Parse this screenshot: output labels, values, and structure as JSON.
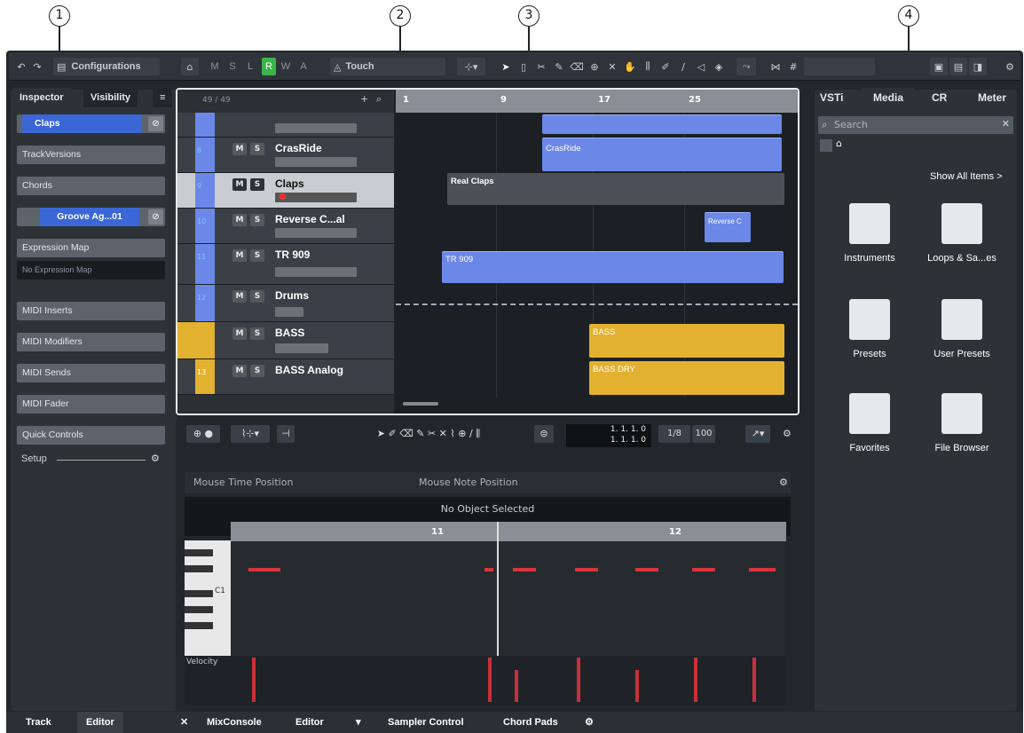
{
  "callouts": [
    "1",
    "2",
    "3",
    "4"
  ],
  "toolbar": {
    "configurations_label": "Configurations",
    "mode_letters": [
      "M",
      "S",
      "L",
      "R",
      "W",
      "A"
    ],
    "automation_mode": "Touch"
  },
  "inspector": {
    "tabs": [
      "Inspector",
      "Visibility"
    ],
    "menu_icon": "≡",
    "track_name": "Claps",
    "rows": [
      "TrackVersions",
      "Chords",
      "Groove Ag...01",
      "Expression Map",
      "No Expression Map",
      "MIDI Inserts",
      "MIDI Modifiers",
      "MIDI Sends",
      "MIDI Fader",
      "Quick Controls"
    ],
    "setup_label": "Setup"
  },
  "project": {
    "track_count": "49 / 49",
    "tracks": [
      {
        "num": "8",
        "name": "CrasRide"
      },
      {
        "num": "9",
        "name": "Claps"
      },
      {
        "num": "10",
        "name": "Reverse C...al"
      },
      {
        "num": "11",
        "name": "TR 909"
      },
      {
        "num": "12",
        "name": "Drums"
      },
      {
        "num": "",
        "name": "BASS"
      },
      {
        "num": "13",
        "name": "BASS Analog"
      }
    ],
    "ruler": [
      "1",
      "9",
      "17",
      "25"
    ],
    "events": [
      "CrasRide",
      "Real Claps",
      "Reverse C",
      "TR 909",
      "BASS",
      "BASS DRY"
    ]
  },
  "editor": {
    "time_display": [
      "1. 1. 1.  0",
      "1. 1. 1.  0"
    ],
    "quantize": "1/8",
    "velocity_value": "100",
    "mouse_time": "Mouse Time Position",
    "mouse_note": "Mouse Note Position",
    "no_object": "No Object Selected",
    "ruler": [
      "11",
      "12"
    ],
    "key_label": "C1",
    "lane_label": "Velocity"
  },
  "media": {
    "tabs": [
      "VSTi",
      "Media",
      "CR",
      "Meter"
    ],
    "search_placeholder": "Search",
    "show_all": "Show All Items >",
    "tiles": [
      "Instruments",
      "Loops & Sa...es",
      "Presets",
      "User Presets",
      "Favorites",
      "File Browser"
    ]
  },
  "bottom": {
    "left_tabs": [
      "Track",
      "Editor"
    ],
    "center_tabs": [
      "MixConsole",
      "Editor",
      "Sampler Control",
      "Chord Pads"
    ]
  },
  "colors": {
    "accent_blue": "#6b88e8",
    "accent_gold": "#e3b130",
    "record_red": "#d8343a",
    "r_green": "#3bb54a"
  }
}
